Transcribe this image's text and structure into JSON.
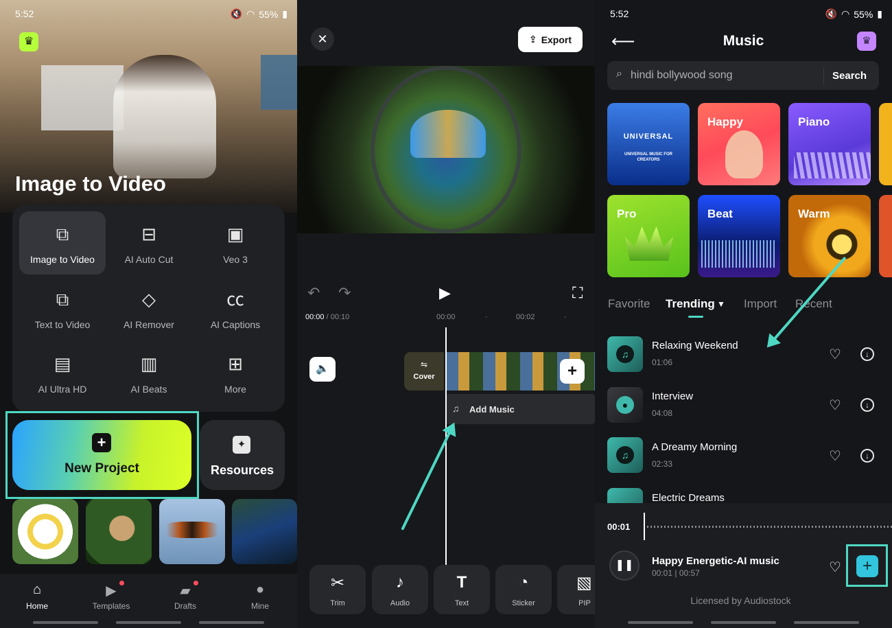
{
  "home": {
    "status": {
      "time": "5:52",
      "battery": "55%"
    },
    "hero_title": "Image to Video",
    "tools": [
      {
        "label": "Image to Video",
        "icon": "image-to-video-icon"
      },
      {
        "label": "AI Auto Cut",
        "icon": "auto-cut-icon"
      },
      {
        "label": "Veo 3",
        "icon": "veo3-icon"
      },
      {
        "label": "Text to Video",
        "icon": "text-to-video-icon"
      },
      {
        "label": "AI Remover",
        "icon": "eraser-icon"
      },
      {
        "label": "AI Captions",
        "icon": "captions-icon"
      },
      {
        "label": "AI Ultra HD",
        "icon": "hd-icon"
      },
      {
        "label": "AI Beats",
        "icon": "beats-icon"
      },
      {
        "label": "More",
        "icon": "grid-icon"
      }
    ],
    "new_project_label": "New Project",
    "resources_label": "Resources",
    "nav": [
      {
        "label": "Home",
        "icon": "home-icon"
      },
      {
        "label": "Templates",
        "icon": "templates-icon"
      },
      {
        "label": "Drafts",
        "icon": "drafts-icon"
      },
      {
        "label": "Mine",
        "icon": "profile-icon"
      }
    ]
  },
  "editor": {
    "export_label": "Export",
    "time_current": "00:00",
    "time_total": "/ 00:10",
    "ticks": [
      "00:00",
      "00:02"
    ],
    "cover_label": "Cover",
    "add_music_label": "Add Music",
    "toolbar": [
      {
        "label": "Trim",
        "icon": "scissors-icon"
      },
      {
        "label": "Audio",
        "icon": "music-note-icon"
      },
      {
        "label": "Text",
        "icon": "text-icon"
      },
      {
        "label": "Sticker",
        "icon": "sticker-icon"
      },
      {
        "label": "PIP",
        "icon": "pip-icon"
      }
    ]
  },
  "music": {
    "status": {
      "time": "5:52",
      "battery": "55%"
    },
    "title": "Music",
    "search": {
      "value": "",
      "placeholder": "hindi bollywood song",
      "button": "Search"
    },
    "categories": [
      {
        "label": "",
        "brand_text": "UNIVERSAL",
        "brand_sub": "UNIVERSAL MUSIC FOR CREATORS"
      },
      {
        "label": "Happy"
      },
      {
        "label": "Piano"
      },
      {
        "label": "Pro"
      },
      {
        "label": "Beat"
      },
      {
        "label": "Warm"
      }
    ],
    "tabs": [
      "Favorite",
      "Trending",
      "Import",
      "Recent"
    ],
    "tracks": [
      {
        "name": "Relaxing Weekend",
        "duration": "01:06"
      },
      {
        "name": "Interview",
        "duration": "04:08"
      },
      {
        "name": "A Dreamy Morning",
        "duration": "02:33"
      },
      {
        "name": "Electric Dreams",
        "duration": ""
      }
    ],
    "player": {
      "time": "00:01",
      "track_name": "Happy Energetic-AI music",
      "track_time": "00:01 | 00:57",
      "license": "Licensed by Audiostock"
    }
  }
}
